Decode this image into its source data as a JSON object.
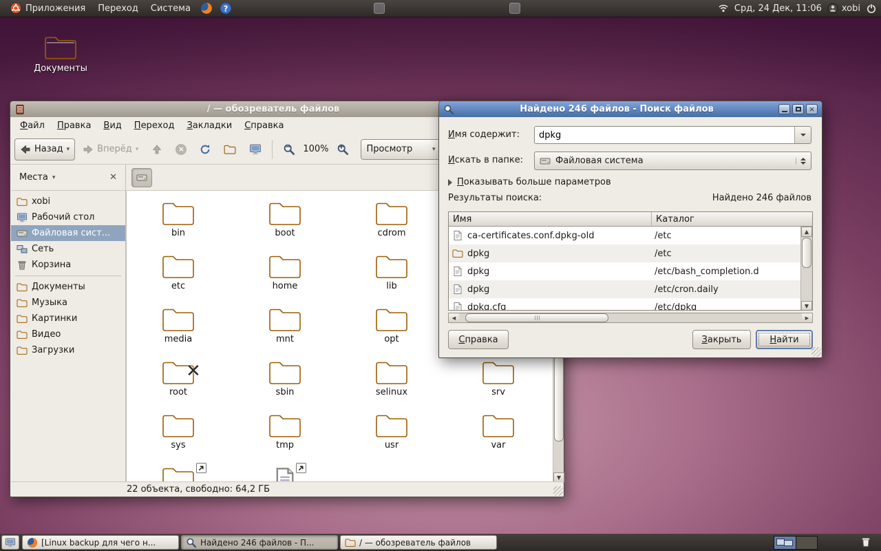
{
  "top_panel": {
    "menus": [
      "Приложения",
      "Переход",
      "Система"
    ],
    "clock": "Срд, 24 Дек, 11:06",
    "username": "xobi"
  },
  "desktop": {
    "documents_label": "Документы"
  },
  "file_browser": {
    "title": "/ — обозреватель файлов",
    "menu": [
      "Файл",
      "Правка",
      "Вид",
      "Переход",
      "Закладки",
      "Справка"
    ],
    "toolbar": {
      "back": "Назад",
      "forward": "Вперёд",
      "zoom_level": "100%",
      "view_label": "Просмотр"
    },
    "sidebar": {
      "header": "Места",
      "items": [
        "xobi",
        "Рабочий стол",
        "Файловая сист...",
        "Сеть",
        "Корзина",
        "Документы",
        "Музыка",
        "Картинки",
        "Видео",
        "Загрузки"
      ]
    },
    "folders": [
      "bin",
      "boot",
      "cdrom",
      "etc",
      "home",
      "lib",
      "media",
      "mnt",
      "opt",
      "root",
      "sbin",
      "selinux",
      "srv",
      "sys",
      "tmp",
      "usr",
      "var"
    ],
    "status": "22 объекта, свободно: 64,2 ГБ"
  },
  "search_dialog": {
    "title": "Найдено 246 файлов - Поиск файлов",
    "name_contains_label": "Имя содержит:",
    "name_contains_value": "dpkg",
    "look_in_label": "Искать в папке:",
    "look_in_value": "Файловая система",
    "more_options": "Показывать больше параметров",
    "results_label": "Результаты поиска:",
    "results_count": "Найдено 246 файлов",
    "columns": [
      "Имя",
      "Каталог"
    ],
    "rows": [
      {
        "name": "ca-certificates.conf.dpkg-old",
        "folder": "/etc"
      },
      {
        "name": "dpkg",
        "folder": "/etc"
      },
      {
        "name": "dpkg",
        "folder": "/etc/bash_completion.d"
      },
      {
        "name": "dpkg",
        "folder": "/etc/cron.daily"
      },
      {
        "name": "dpkg.cfg",
        "folder": "/etc/dpkg"
      }
    ],
    "help_button": "Справка",
    "close_button": "Закрыть",
    "find_button": "Найти"
  },
  "taskbar": {
    "windows": [
      "[Linux backup для чего н...",
      "Найдено 246 файлов - П...",
      "/ — обозреватель файлов"
    ]
  }
}
